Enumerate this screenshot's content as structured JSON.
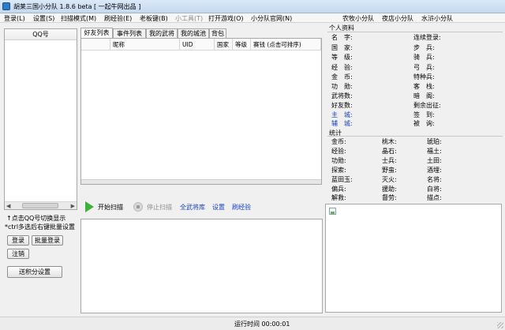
{
  "window": {
    "title": "胡莱三国小分队 1.8.6 beta [ 一起牛网出品 ]"
  },
  "menu": [
    {
      "label": "登录(L)",
      "disabled": false
    },
    {
      "label": "设置(S)",
      "disabled": false
    },
    {
      "label": "扫描模式(M)",
      "disabled": false
    },
    {
      "label": "刷经验(E)",
      "disabled": false
    },
    {
      "label": "老板键(B)",
      "disabled": false
    },
    {
      "label": "小工具(T)",
      "disabled": true
    },
    {
      "label": "打开游戏(O)",
      "disabled": false
    },
    {
      "label": "小分队官网(N)",
      "disabled": false
    },
    {
      "label": "农牧小分队",
      "disabled": false
    },
    {
      "label": "夜店小分队",
      "disabled": false
    },
    {
      "label": "水浒小分队",
      "disabled": false
    }
  ],
  "left_panel": {
    "list_header": "QQ号",
    "hint_line1": "↑点击QQ号切换显示",
    "hint_line2": "*ctrl多选后右键批量设置",
    "buttons": {
      "login": "登录",
      "batch_login": "批量登录",
      "logout": "注销",
      "send_points": "送积分设置"
    }
  },
  "tabs": [
    "好友列表",
    "事件列表",
    "我的武将",
    "我的城池",
    "背包"
  ],
  "table": {
    "columns": [
      "",
      "昵称",
      "UID",
      "国家",
      "等级",
      "赛钱 (点击可排序)"
    ]
  },
  "scan_toolbar": {
    "start": "开始扫描",
    "stop": "停止扫描",
    "all_generals": "全武将库",
    "settings": "设置",
    "refresh_exp": "刷经验"
  },
  "personal_info": {
    "heading": "个人资料",
    "left_labels": [
      "名　字:",
      "国　家:",
      "等　级:",
      "经　验:",
      "金　币:",
      "功　勋:",
      "武将数:",
      "好友数:",
      "主　城:",
      "辅　城:"
    ],
    "right_labels": [
      "连续登录:",
      "步　兵:",
      "骑　兵:",
      "弓　兵:",
      "特种兵:",
      "客　栈:",
      "暗　阁:",
      "剩余出征:",
      "签　到:",
      "被　询:"
    ]
  },
  "stats": {
    "heading": "统计",
    "col1": [
      "金币:",
      "经验:",
      "功勋:",
      "探索:",
      "蓝田玉:",
      "偏兵:",
      "解救:"
    ],
    "col2": [
      "桃木:",
      "晶石:",
      "士兵:",
      "野蛮:",
      "灭火:",
      "援助:",
      "督劳:"
    ],
    "col3": [
      "琥珀:",
      "福土:",
      "土田:",
      "酒埋:",
      "名将:",
      "白将:",
      "描点:"
    ]
  },
  "status_bar": {
    "runtime_label": "运行时间 00:00:01"
  }
}
